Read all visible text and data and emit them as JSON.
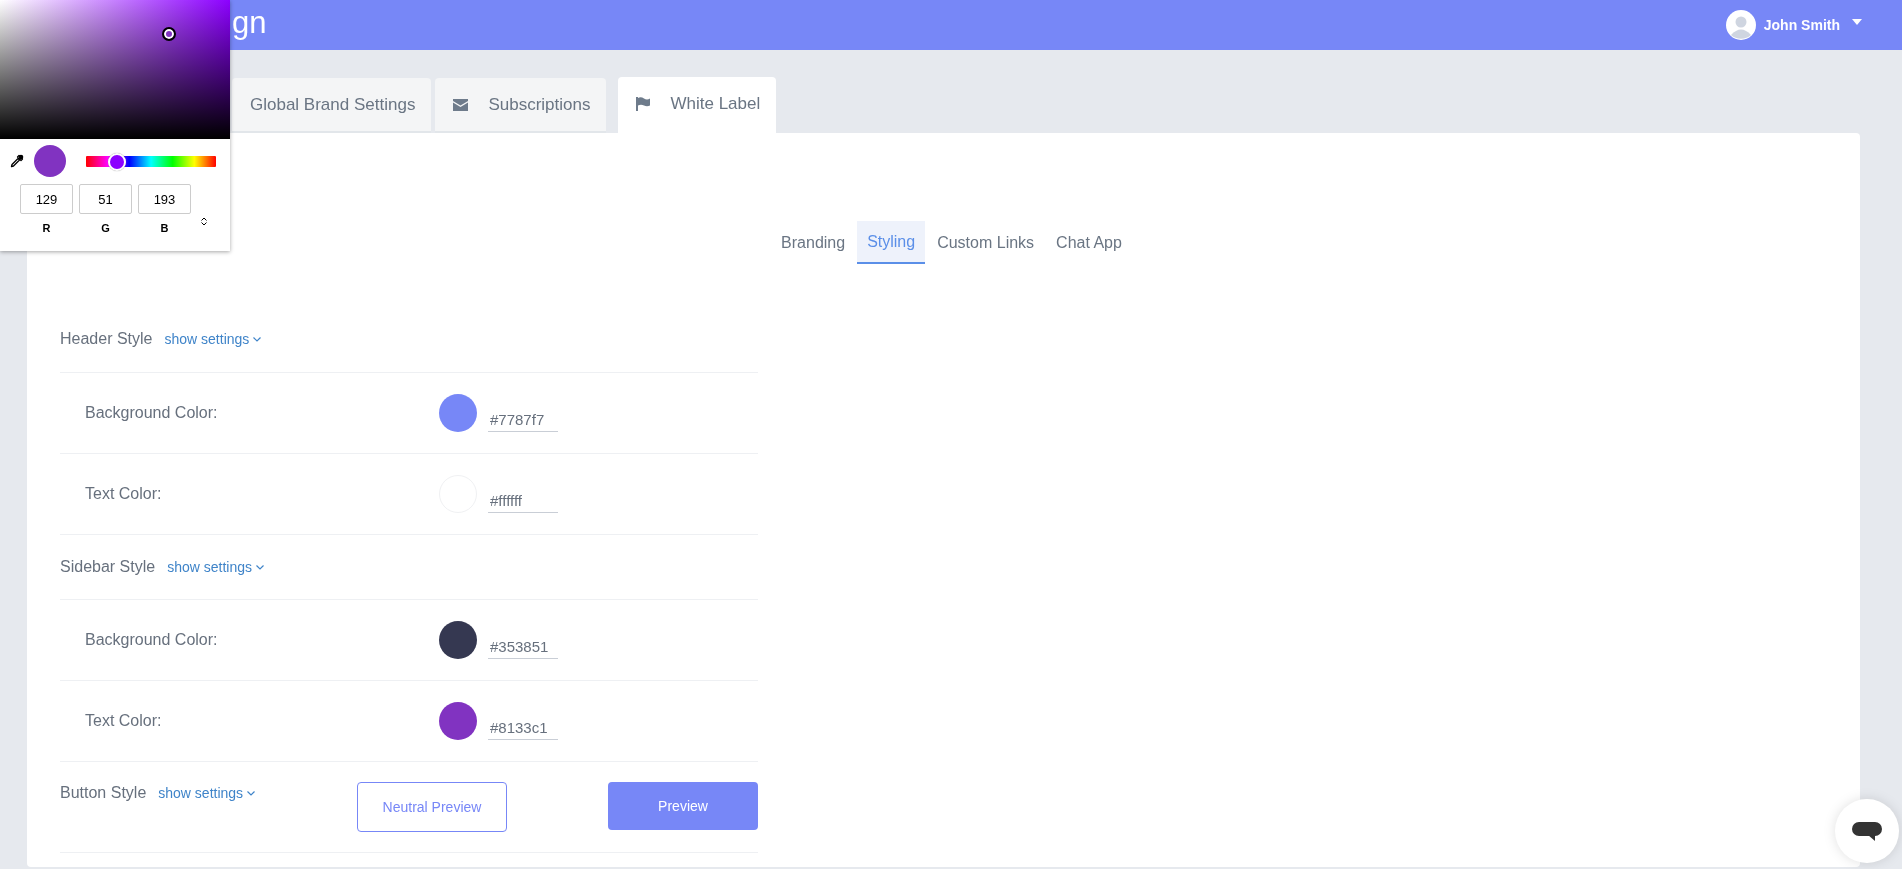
{
  "header": {
    "title": "gn",
    "user_name": "John Smith"
  },
  "main_tabs": [
    {
      "label": "Global Brand Settings",
      "selected": false
    },
    {
      "label": "Subscriptions",
      "selected": false
    },
    {
      "label": "White Label",
      "selected": true
    }
  ],
  "sub_tabs": [
    {
      "label": "Branding",
      "selected": false
    },
    {
      "label": "Styling",
      "selected": true
    },
    {
      "label": "Custom Links",
      "selected": false
    },
    {
      "label": "Chat App",
      "selected": false
    }
  ],
  "sections": [
    {
      "title": "Header Style",
      "link": "show settings",
      "rows": [
        {
          "label": "Background Color:",
          "value": "#7787f7",
          "color": "#7787f7"
        },
        {
          "label": "Text Color:",
          "value": "#ffffff",
          "color": "#ffffff"
        }
      ]
    },
    {
      "title": "Sidebar Style",
      "link": "show settings",
      "rows": [
        {
          "label": "Background Color:",
          "value": "#353851",
          "color": "#353851"
        },
        {
          "label": "Text Color:",
          "value": "#8133c1",
          "color": "#8133c1"
        }
      ]
    },
    {
      "title": "Button Style",
      "link": "show settings",
      "buttons": [
        {
          "label": "Neutral Preview",
          "kind": "outline"
        },
        {
          "label": "Preview",
          "kind": "filled"
        }
      ]
    }
  ],
  "color_picker": {
    "color": "#8133c1",
    "level": 0.24,
    "channels": [
      {
        "value": "129",
        "label": "R"
      },
      {
        "value": "51",
        "label": "G"
      },
      {
        "value": "193",
        "label": "B"
      }
    ]
  }
}
